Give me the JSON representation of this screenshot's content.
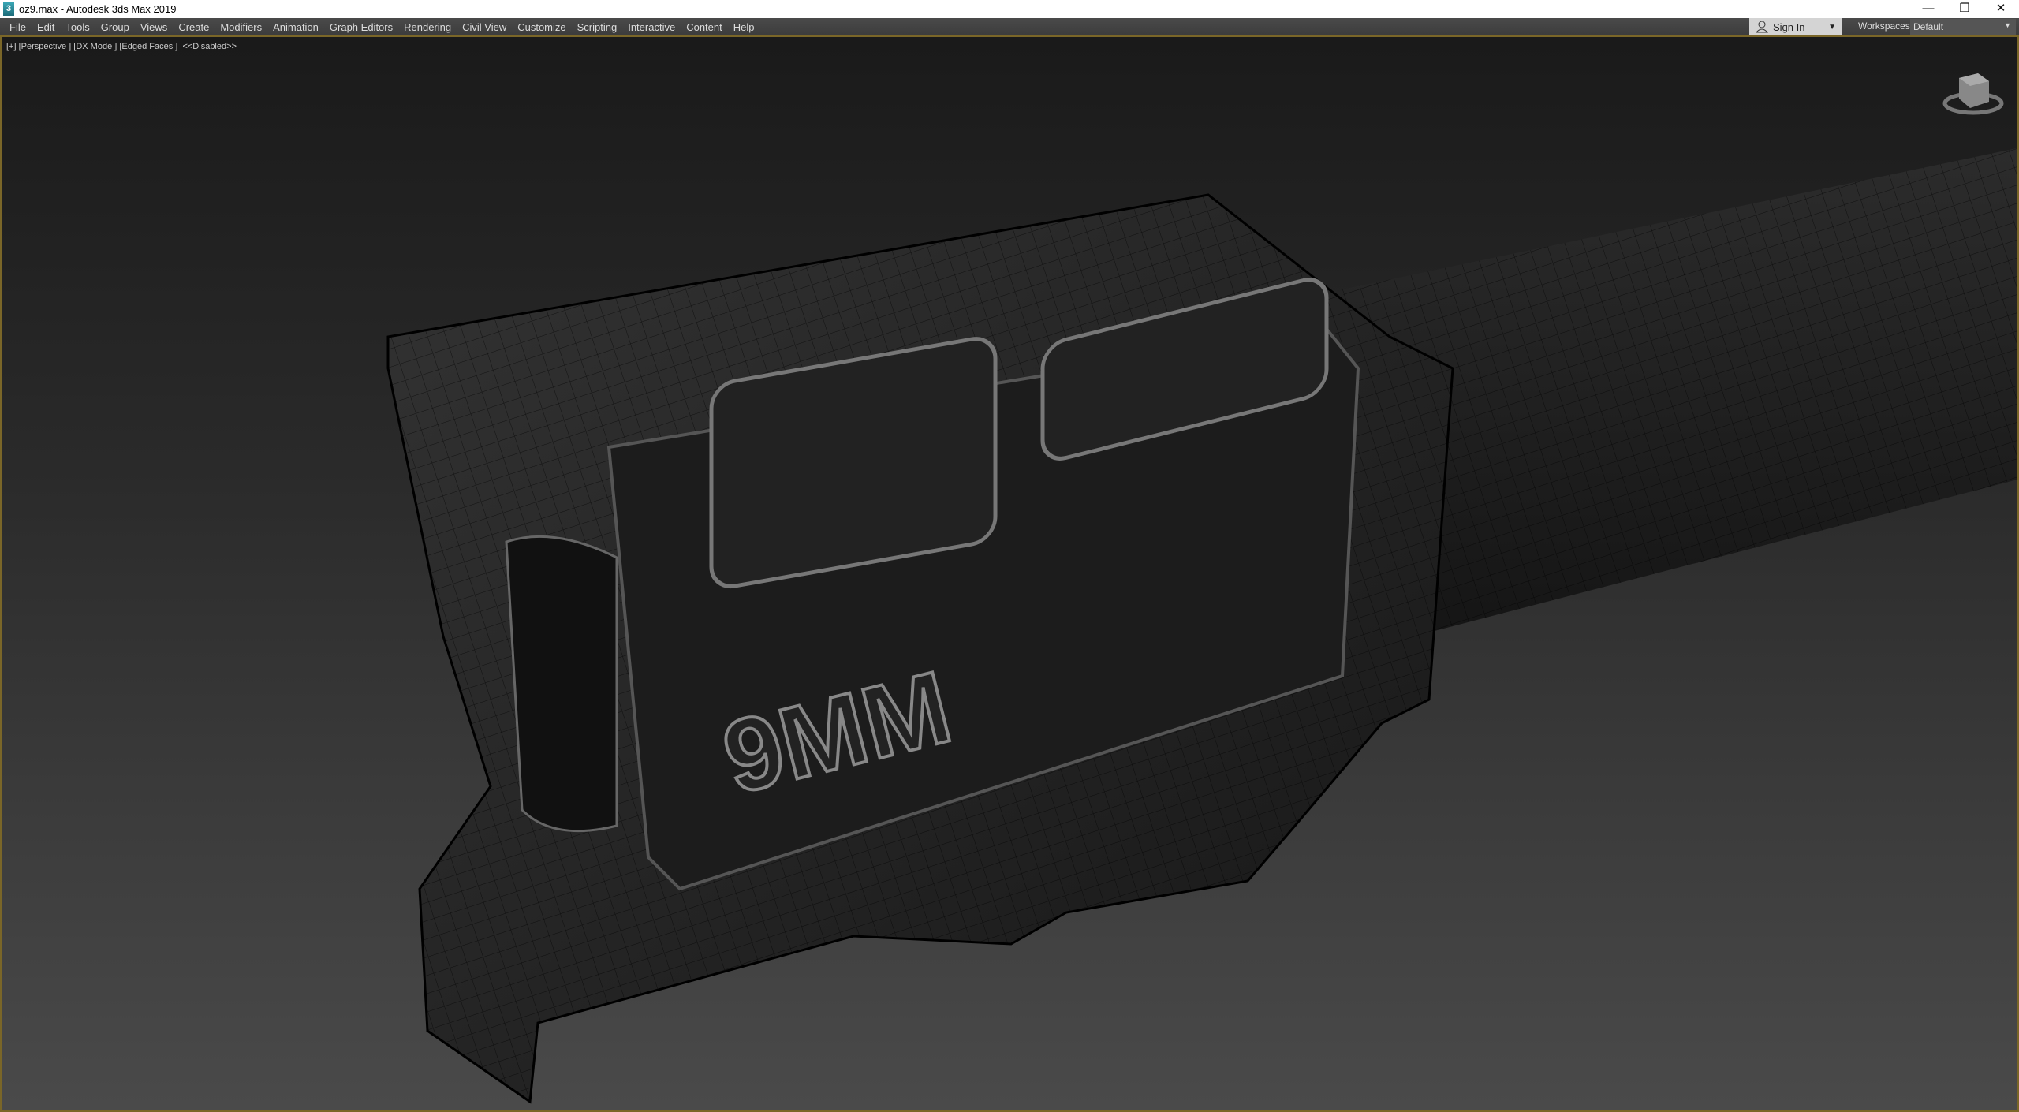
{
  "window": {
    "title": "oz9.max - Autodesk 3ds Max 2019",
    "minimize": "—",
    "restore": "❐",
    "close": "✕"
  },
  "menu": [
    "File",
    "Edit",
    "Tools",
    "Group",
    "Views",
    "Create",
    "Modifiers",
    "Animation",
    "Graph Editors",
    "Rendering",
    "Civil View",
    "Customize",
    "Scripting",
    "Interactive",
    "Content",
    "Help"
  ],
  "signin": {
    "label": "Sign In",
    "icon": "user-icon"
  },
  "workspaces": {
    "label": "Workspaces:",
    "value": "Default"
  },
  "viewport": {
    "label": "[+] [Perspective ] [DX Mode ] [Edged Faces ]  <<Disabled>>",
    "border_color": "#7a6628",
    "logo_text": "9MM"
  }
}
